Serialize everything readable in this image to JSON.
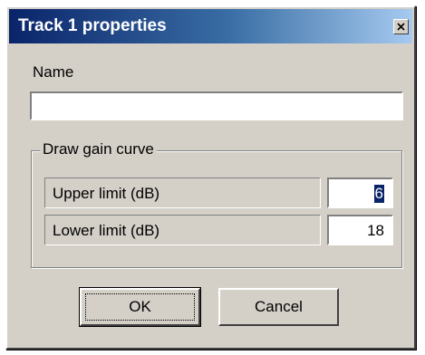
{
  "window": {
    "title": "Track 1 properties",
    "close_icon": "close-icon"
  },
  "name_field": {
    "label": "Name",
    "value": ""
  },
  "gain_group": {
    "legend": "Draw gain curve",
    "rows": [
      {
        "label": "Upper limit (dB)",
        "value": "6",
        "selected": true
      },
      {
        "label": "Lower limit (dB)",
        "value": "18",
        "selected": false
      }
    ]
  },
  "buttons": {
    "ok_label": "OK",
    "cancel_label": "Cancel"
  },
  "colors": {
    "title_gradient_start": "#0a246a",
    "title_gradient_end": "#a6caf0",
    "dialog_face": "#d4d0c8",
    "selection": "#0a246a"
  }
}
